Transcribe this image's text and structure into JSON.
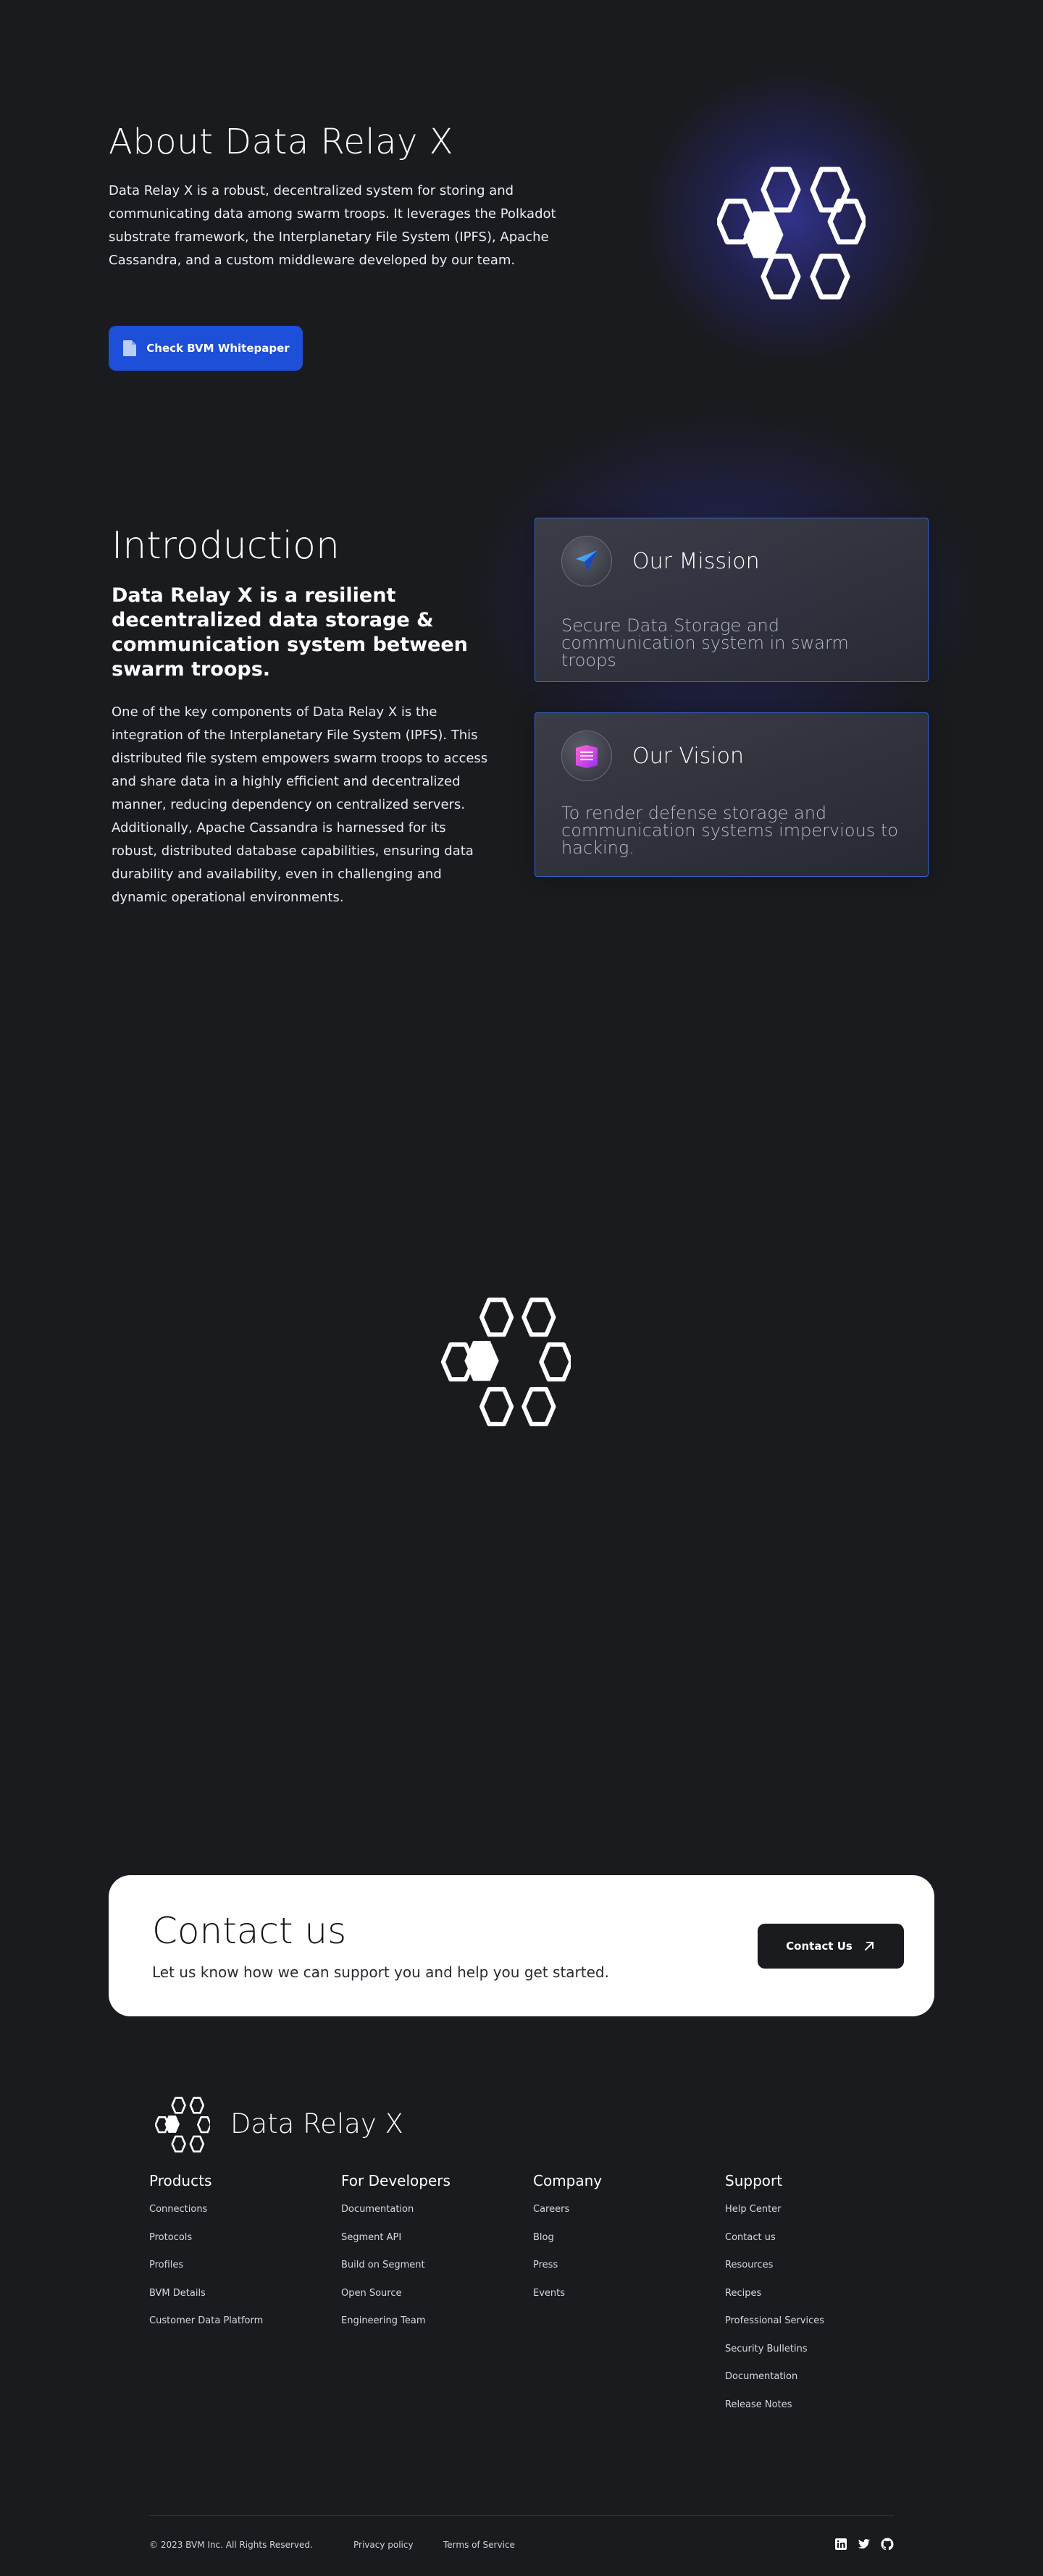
{
  "about": {
    "title": "About Data Relay X",
    "text": "Data Relay X is a robust, decentralized system for storing and communicating data among swarm troops. It leverages the Polkadot substrate framework, the Interplanetary File System (IPFS), Apache Cassandra, and a custom middleware developed by our team.",
    "button_label": "Check BVM Whitepaper",
    "button_icon": "document-icon"
  },
  "intro": {
    "title": "Introduction",
    "subtitle": "Data Relay X is a resilient decentralized data storage & communication system between swarm troops.",
    "body": "One of the key components of Data Relay X is the integration of the Interplanetary File System (IPFS). This distributed file system empowers swarm troops to access and share data in a highly efficient and decentralized manner, reducing dependency on centralized servers. Additionally, Apache Cassandra is harnessed for its robust, distributed database capabilities, ensuring data durability and availability, even in challenging and dynamic operational environments."
  },
  "cards": {
    "mission": {
      "title": "Our Mission",
      "text": "Secure Data Storage and communication system in swarm troops",
      "icon": "paper-plane-icon"
    },
    "vision": {
      "title": "Our Vision",
      "text": "To render defense storage and communication systems impervious to hacking.",
      "icon": "book-icon"
    }
  },
  "contact": {
    "title": "Contact us",
    "text": "Let us know how we can support you and help you get started.",
    "button_label": "Contact Us",
    "button_icon": "arrow-up-right-icon"
  },
  "footer": {
    "brand": "Data Relay X",
    "columns": [
      {
        "title": "Products",
        "links": [
          "Connections",
          "Protocols",
          "Profiles",
          "BVM Details",
          "Customer Data Platform"
        ]
      },
      {
        "title": "For Developers",
        "links": [
          "Documentation",
          "Segment API",
          "Build on Segment",
          "Open Source",
          "Engineering Team"
        ]
      },
      {
        "title": "Company",
        "links": [
          "Careers",
          "Blog",
          "Press",
          "Events"
        ]
      },
      {
        "title": "Support",
        "links": [
          "Help Center",
          "Contact us",
          "Resources",
          "Recipes",
          "Professional Services",
          "Security Bulletins",
          "Documentation",
          "Release Notes"
        ]
      }
    ],
    "copyright": "© 2023 BVM Inc. All Rights Reserved.",
    "privacy": "Privacy policy",
    "terms": "Terms of Service",
    "social": [
      "linkedin-icon",
      "twitter-icon",
      "github-icon"
    ]
  },
  "colors": {
    "background": "#1a1b1f",
    "accent_blue": "#1d4fd8",
    "card_border": "#3a64cf",
    "contact_bg": "#ffffff"
  }
}
